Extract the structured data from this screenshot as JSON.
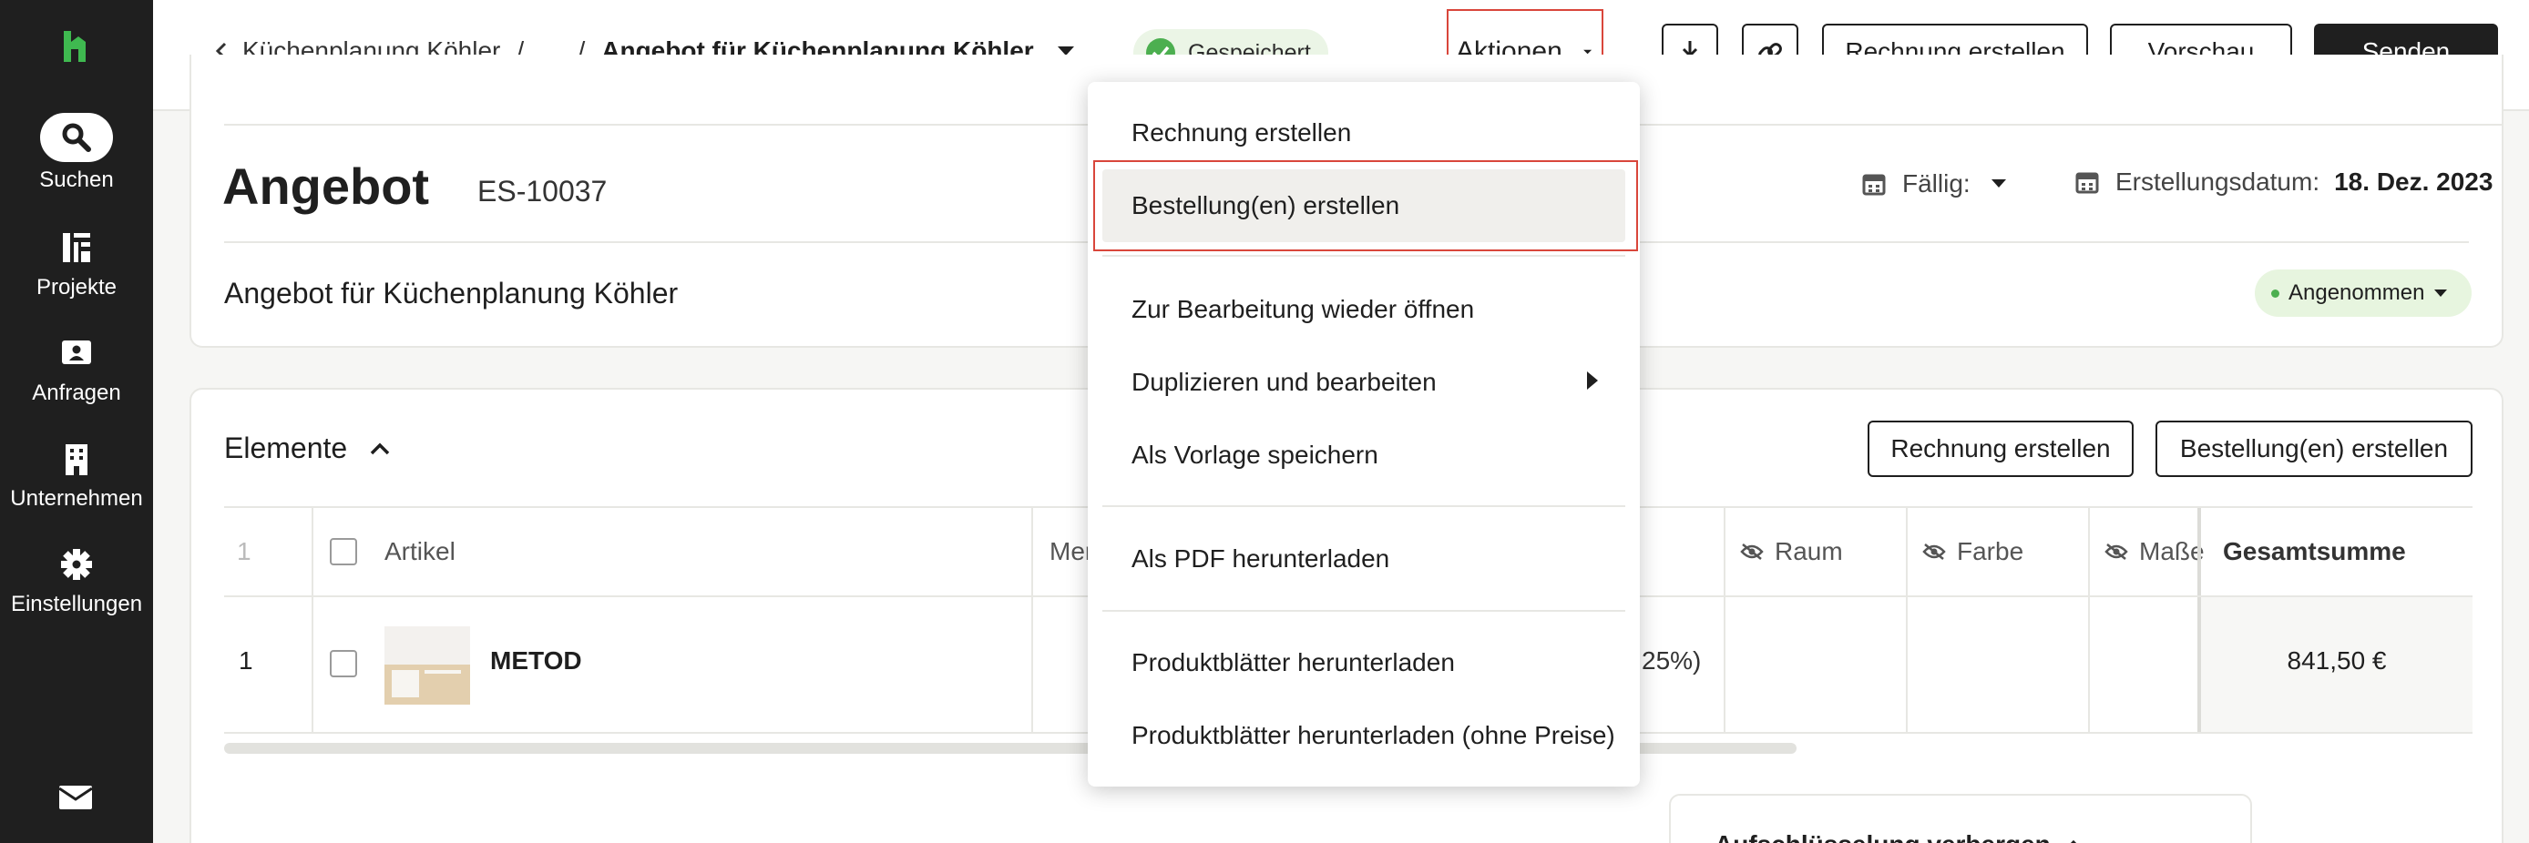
{
  "sidebar": {
    "items": [
      {
        "label": "Suchen",
        "icon": "search-icon"
      },
      {
        "label": "Projekte",
        "icon": "projects-icon"
      },
      {
        "label": "Anfragen",
        "icon": "inquiries-icon"
      },
      {
        "label": "Unternehmen",
        "icon": "company-icon"
      },
      {
        "label": "Einstellungen",
        "icon": "settings-icon"
      }
    ]
  },
  "header": {
    "breadcrumb_project": "Küchenplanung Köhler",
    "breadcrumb_sep1": "/",
    "breadcrumb_ellipsis": "...",
    "breadcrumb_sep2": "/",
    "breadcrumb_current": "Angebot für Küchenplanung Köhler",
    "saved_label": "Gespeichert",
    "actions_label": "Aktionen",
    "invoice_button": "Rechnung erstellen",
    "preview_button": "Vorschau",
    "send_button": "Senden"
  },
  "document": {
    "title": "Angebot",
    "number": "ES-10037",
    "due_label": "Fällig:",
    "created_label": "Erstellungsdatum:",
    "created_value": "18. Dez. 2023",
    "subtitle": "Angebot für Küchenplanung Köhler",
    "status": "Angenommen"
  },
  "elements": {
    "title": "Elemente",
    "invoice_button": "Rechnung erstellen",
    "order_button": "Bestellung(en) erstellen",
    "columns": {
      "index": "1",
      "article": "Artikel",
      "quantity_partial": "Men",
      "room": "Raum",
      "color": "Farbe",
      "dimensions": "Maße",
      "total": "Gesamtsumme"
    },
    "rows": [
      {
        "index": "1",
        "name": "METOD",
        "partial": "25%)",
        "total": "841,50 €"
      }
    ]
  },
  "breakdown": {
    "label": "Aufschlüsselung verbergen"
  },
  "menu": {
    "items": [
      {
        "label": "Rechnung erstellen"
      },
      {
        "label": "Bestellung(en) erstellen"
      },
      {
        "label": "Zur Bearbeitung wieder öffnen"
      },
      {
        "label": "Duplizieren und bearbeiten"
      },
      {
        "label": "Als Vorlage speichern"
      },
      {
        "label": "Als PDF herunterladen"
      },
      {
        "label": "Produktblätter herunterladen"
      },
      {
        "label": "Produktblätter herunterladen (ohne Preise)"
      }
    ]
  },
  "colors": {
    "sidebar": "#1f1f1f",
    "highlight": "#d9463b",
    "success": "#4caf50"
  }
}
